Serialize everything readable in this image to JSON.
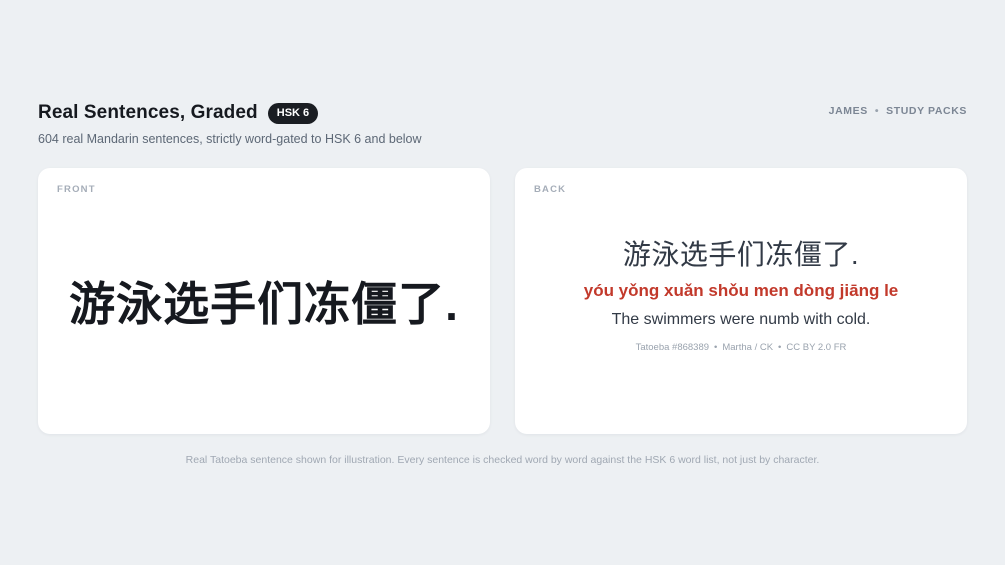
{
  "header": {
    "title": "Real Sentences, Graded",
    "badge": "HSK 6",
    "subtitle": "604 real Mandarin sentences, strictly word-gated to HSK 6 and below",
    "nav": {
      "user": "JAMES",
      "separator": "•",
      "study_packs": "STUDY PACKS"
    }
  },
  "front": {
    "label": "FRONT",
    "hanzi": "游泳选手们冻僵了."
  },
  "back": {
    "label": "BACK",
    "hanzi": "游泳选手们冻僵了.",
    "pinyin": "yóu yǒng xuǎn shǒu men dòng jiāng le",
    "translation": "The swimmers were numb with cold.",
    "attribution": {
      "source": "Tatoeba #868389",
      "authors": "Martha / CK",
      "license": "CC BY 2.0 FR",
      "separator": "•"
    }
  },
  "footnote": "Real Tatoeba sentence shown for illustration. Every sentence is checked word by word against the HSK 6 word list, not just by character.",
  "colors": {
    "background": "#edf0f3",
    "card": "#ffffff",
    "pinyin": "#c2392b",
    "badge": "#1a1d22"
  }
}
